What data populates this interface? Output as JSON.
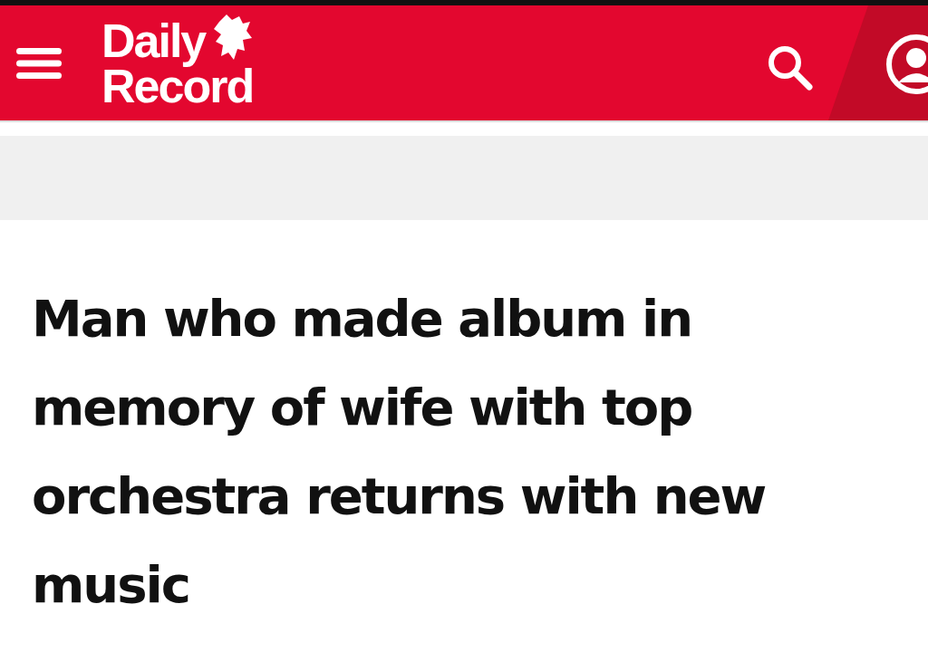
{
  "header": {
    "logo_lines": [
      "Daily",
      "Record"
    ]
  },
  "article": {
    "headline": "Man who made album in memory of wife with top orchestra returns with new music"
  }
}
